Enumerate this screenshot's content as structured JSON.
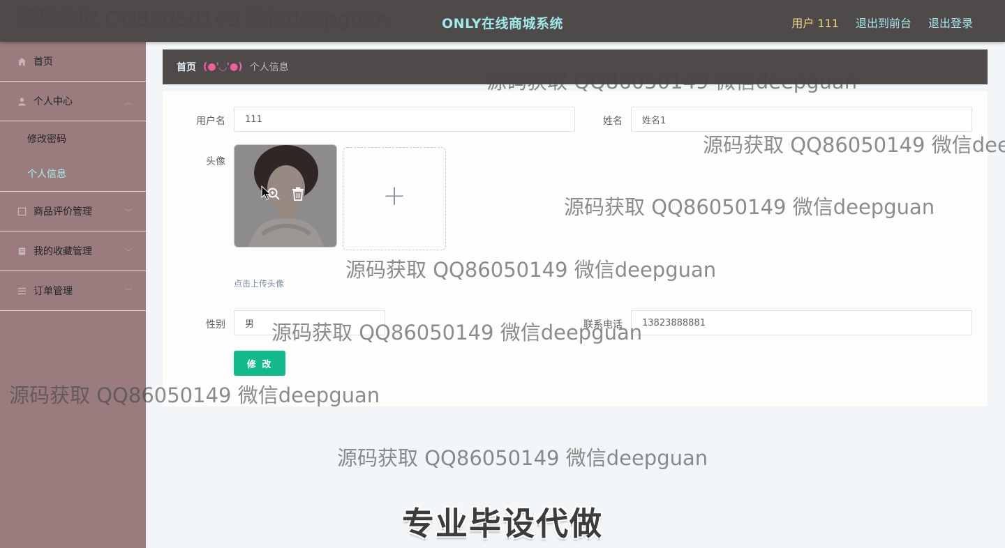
{
  "header": {
    "title": "ONLY在线商城系统",
    "user": "用户 111",
    "links": [
      "退出到前台",
      "退出登录"
    ]
  },
  "sidebar": {
    "items": [
      {
        "label": "首页",
        "icon": "home-icon"
      },
      {
        "label": "个人中心",
        "icon": "user-icon",
        "expanded": true
      },
      {
        "label": "修改密码"
      },
      {
        "label": "个人信息",
        "active": true
      },
      {
        "label": "商品评价管理",
        "icon": "list-icon"
      },
      {
        "label": "我的收藏管理",
        "icon": "star-icon"
      },
      {
        "label": "订单管理",
        "icon": "menu-icon"
      }
    ]
  },
  "breadcrumb": {
    "home": "首页",
    "separator": "(●'◡'●)",
    "current": "个人信息"
  },
  "form": {
    "username_label": "用户名",
    "username_value": "111",
    "name_label": "姓名",
    "name_value": "姓名1",
    "avatar_label": "头像",
    "upload_tip": "点击上传头像",
    "gender_label": "性别",
    "gender_value": "男",
    "phone_label": "联系电话",
    "phone_value": "13823888881",
    "submit_label": "修 改"
  },
  "watermark": {
    "text": "源码获取 QQ86050149 微信deepguan",
    "banner": "专业毕设代做"
  },
  "colors": {
    "header_bg": "#4f4a4a",
    "title": "#a2e8ea",
    "sidebar_bg": "#9a7c7e",
    "active_menu": "#a5ede9",
    "button": "#14b98b"
  }
}
